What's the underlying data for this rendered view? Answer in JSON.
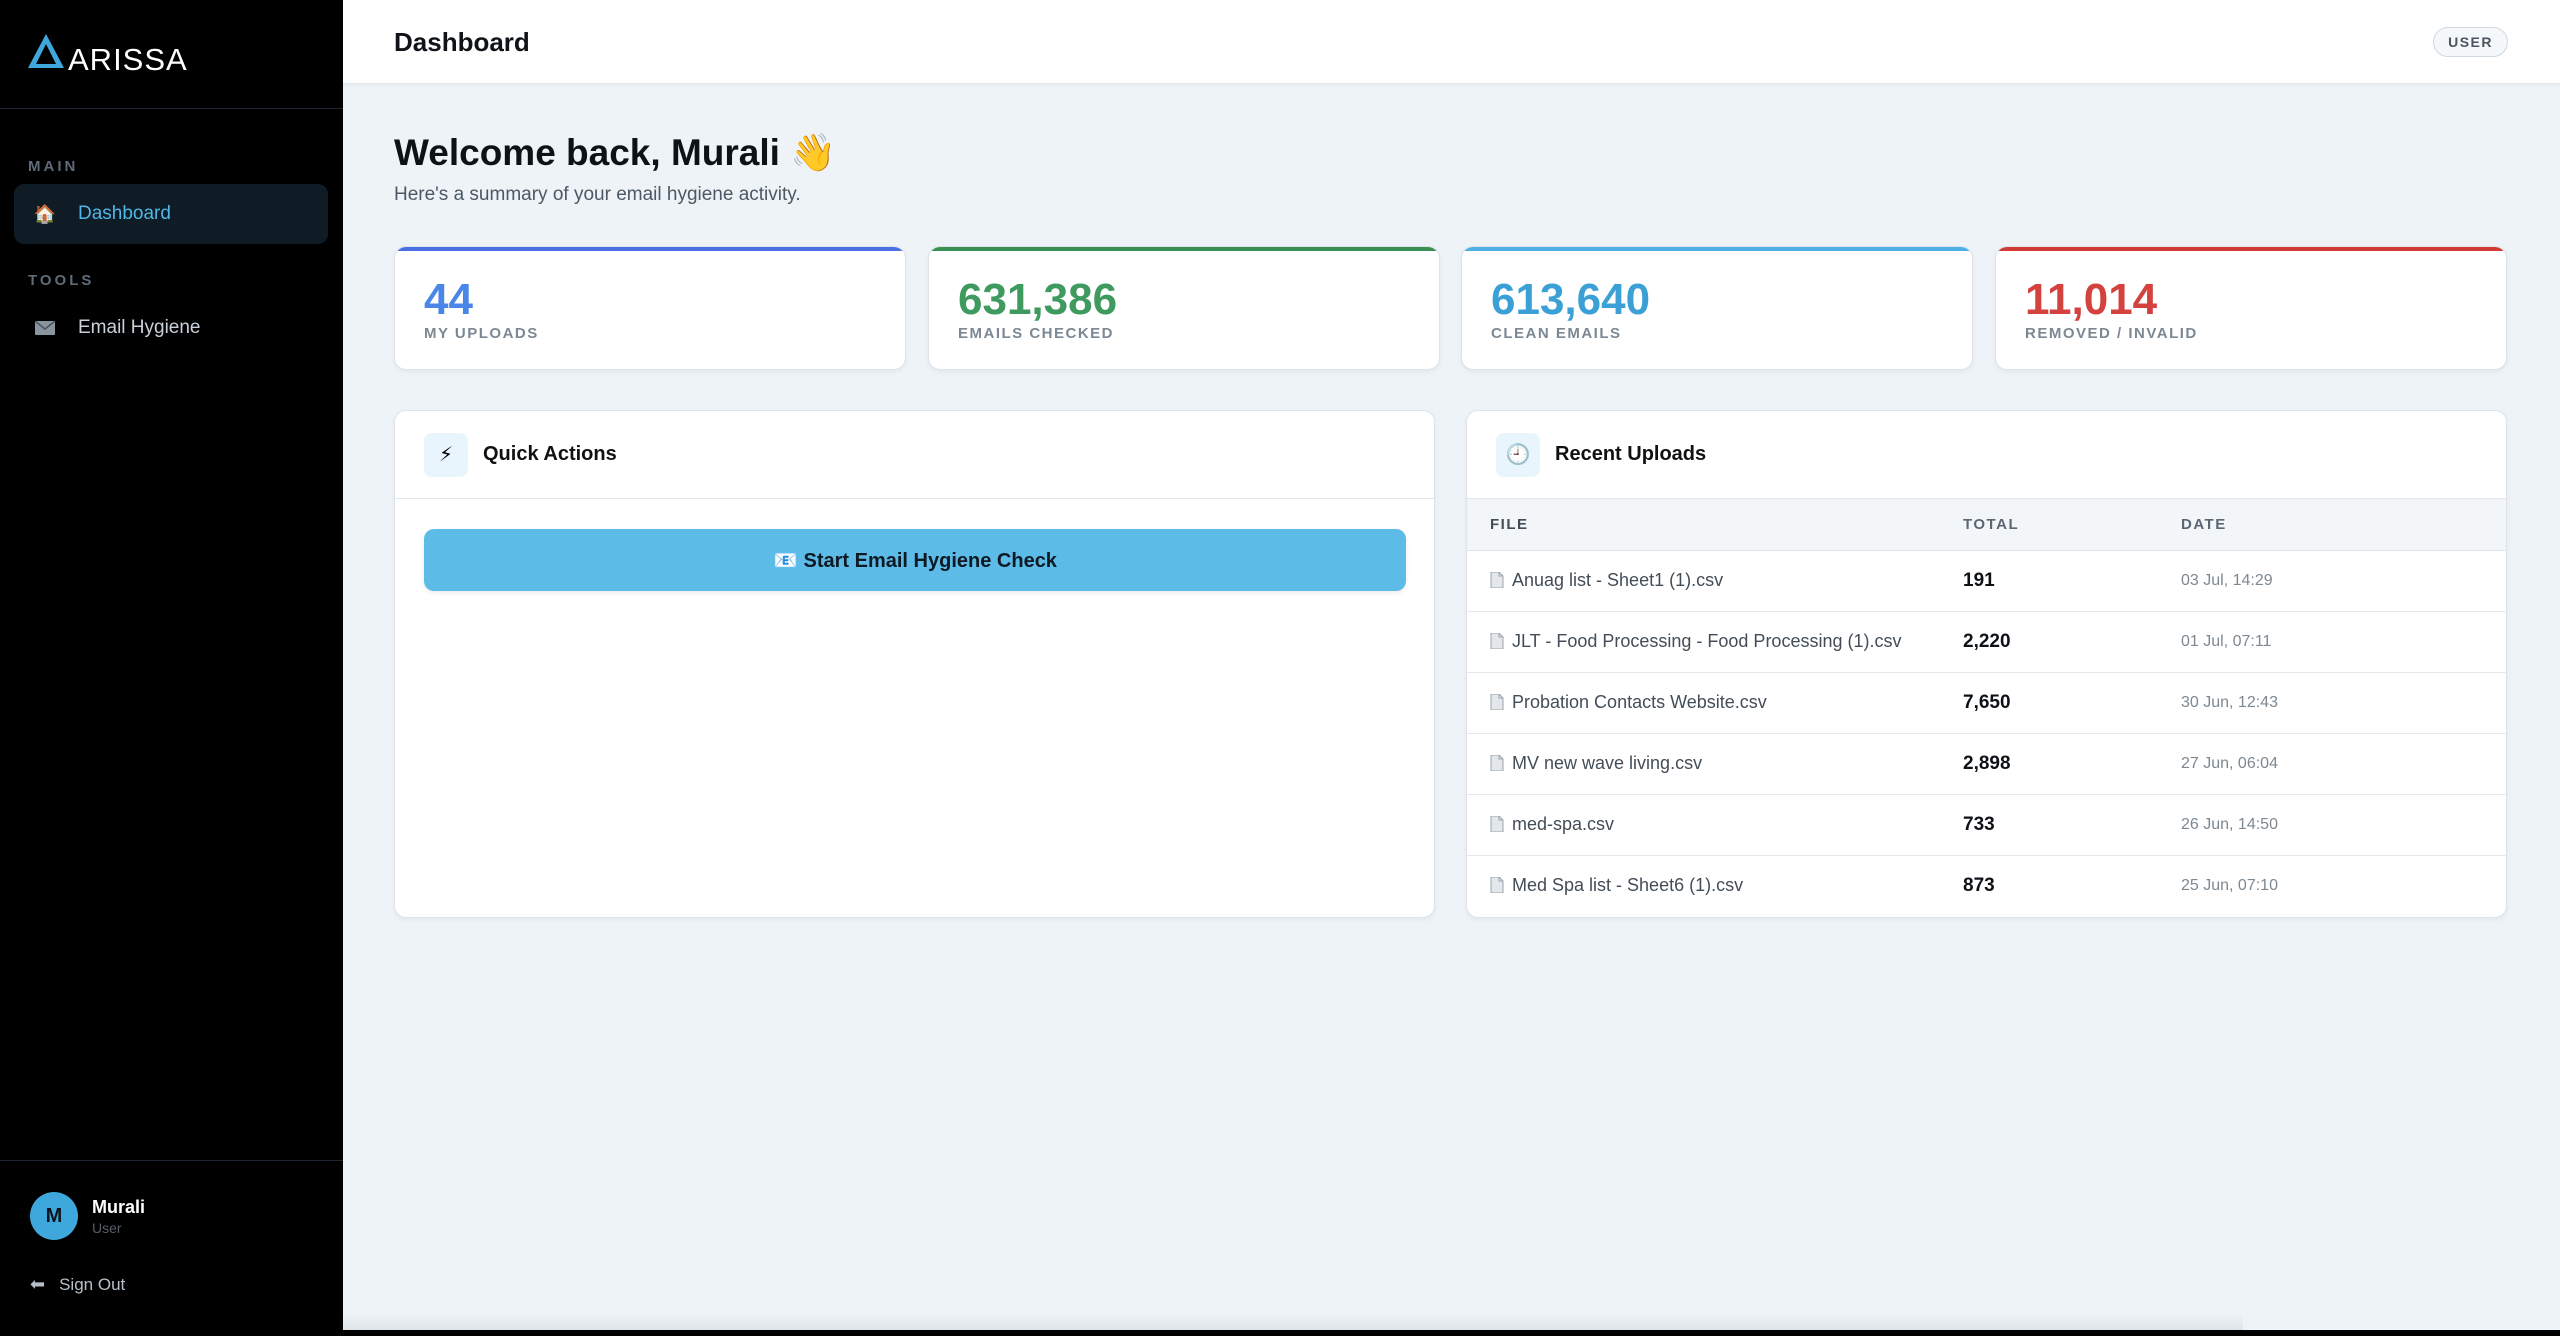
{
  "brand": {
    "logo_text": "ARISSA"
  },
  "sidebar": {
    "sections": [
      {
        "label": "MAIN",
        "items": [
          {
            "label": "Dashboard",
            "icon": "house-icon",
            "active": true
          }
        ]
      },
      {
        "label": "TOOLS",
        "items": [
          {
            "label": "Email Hygiene",
            "icon": "envelope-icon",
            "active": false
          }
        ]
      }
    ],
    "user": {
      "initial": "M",
      "name": "Murali",
      "role": "User"
    },
    "signout_label": "Sign Out"
  },
  "header": {
    "title": "Dashboard",
    "role_badge": "USER"
  },
  "welcome": {
    "heading": "Welcome back, Murali",
    "emoji": "👋",
    "subtitle": "Here's a summary of your email hygiene activity."
  },
  "stats": [
    {
      "value": "44",
      "label": "MY UPLOADS",
      "color": "#4a86e8",
      "bar_color": "#4a6fe3"
    },
    {
      "value": "631,386",
      "label": "EMAILS CHECKED",
      "color": "#3f9a5f",
      "bar_color": "#3a8f52"
    },
    {
      "value": "613,640",
      "label": "CLEAN EMAILS",
      "color": "#3aa0d6",
      "bar_color": "#4cb0e6"
    },
    {
      "value": "11,014",
      "label": "REMOVED / INVALID",
      "color": "#d4423f",
      "bar_color": "#d23a36"
    }
  ],
  "quick_actions": {
    "title": "Quick Actions",
    "icon": "lightning-icon",
    "button_label": "📧 Start Email Hygiene Check"
  },
  "recent_uploads": {
    "title": "Recent Uploads",
    "icon": "clock-icon",
    "columns": [
      "FILE",
      "TOTAL",
      "DATE"
    ],
    "rows": [
      {
        "file": "Anuag list - Sheet1 (1).csv",
        "total": "191",
        "date": "03 Jul, 14:29"
      },
      {
        "file": "JLT - Food Processing - Food Processing (1).csv",
        "total": "2,220",
        "date": "01 Jul, 07:11"
      },
      {
        "file": "Probation Contacts Website.csv",
        "total": "7,650",
        "date": "30 Jun, 12:43"
      },
      {
        "file": "MV new wave living.csv",
        "total": "2,898",
        "date": "27 Jun, 06:04"
      },
      {
        "file": "med-spa.csv",
        "total": "733",
        "date": "26 Jun, 14:50"
      },
      {
        "file": "Med Spa list - Sheet6 (1).csv",
        "total": "873",
        "date": "25 Jun, 07:10"
      }
    ]
  }
}
